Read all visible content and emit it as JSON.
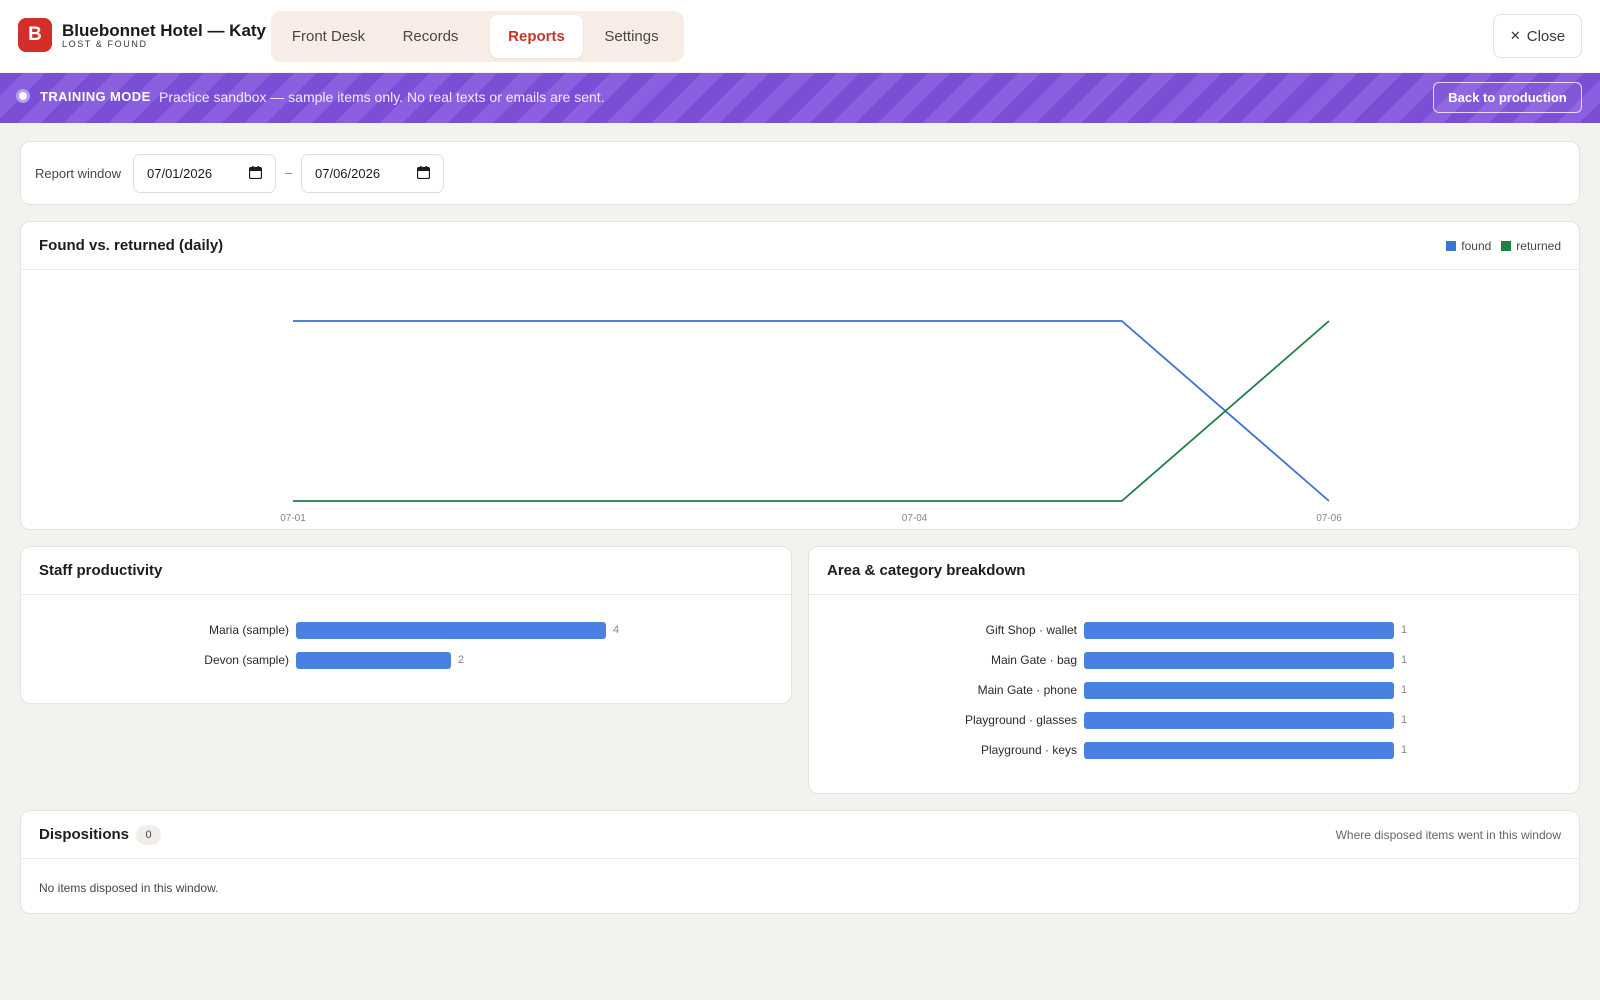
{
  "app": {
    "logo_letter": "B",
    "title": "Bluebonnet Hotel — Katy",
    "subtitle": "LOST & FOUND",
    "close_label": "Close"
  },
  "tabs": [
    {
      "label": "Front Desk",
      "active": false
    },
    {
      "label": "Records",
      "active": false
    },
    {
      "label": "Reports",
      "active": true
    },
    {
      "label": "Settings",
      "active": false
    }
  ],
  "banner": {
    "mode": "TRAINING MODE",
    "message": "Practice sandbox — sample items only. No real texts or emails are sent.",
    "back_label": "Back to production"
  },
  "report_window": {
    "label": "Report window",
    "start": "07/01/2026",
    "end": "07/06/2026",
    "separator": "–"
  },
  "colors": {
    "found": "#3a72d6",
    "returned": "#1f8048",
    "bar": "#4a80e2",
    "accent": "#c8352d",
    "training": "#7a4fd6"
  },
  "chart_data": [
    {
      "type": "line",
      "title": "Found vs. returned (daily)",
      "x": [
        "07-01",
        "07-02",
        "07-03",
        "07-04",
        "07-05",
        "07-06"
      ],
      "x_tick_labels": [
        "07-01",
        "07-04",
        "07-06"
      ],
      "series": [
        {
          "name": "found",
          "values": [
            1,
            1,
            1,
            1,
            1,
            0
          ]
        },
        {
          "name": "returned",
          "values": [
            0,
            0,
            0,
            0,
            0,
            1
          ]
        }
      ],
      "ylim": [
        0,
        1
      ],
      "grid": false,
      "legend": "top-right"
    },
    {
      "type": "bar",
      "orientation": "horizontal",
      "title": "Staff productivity",
      "categories": [
        "Maria (sample)",
        "Devon (sample)"
      ],
      "values": [
        4,
        2
      ],
      "xlim": [
        0,
        4
      ]
    },
    {
      "type": "bar",
      "orientation": "horizontal",
      "title": "Area & category breakdown",
      "categories": [
        "Gift Shop · wallet",
        "Main Gate · bag",
        "Main Gate · phone",
        "Playground · glasses",
        "Playground · keys"
      ],
      "values": [
        1,
        1,
        1,
        1,
        1
      ],
      "xlim": [
        0,
        1
      ]
    }
  ],
  "dispositions": {
    "title": "Dispositions",
    "count": "0",
    "note": "Where disposed items went in this window",
    "empty": "No items disposed in this window."
  }
}
